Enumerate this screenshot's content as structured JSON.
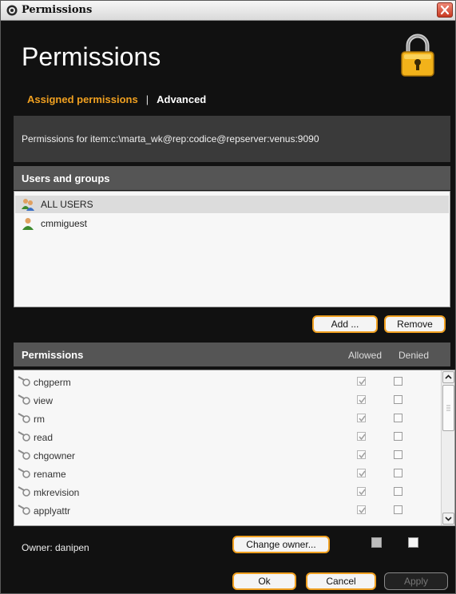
{
  "window": {
    "title": "Permissions"
  },
  "header": {
    "title": "Permissions",
    "tabs": [
      {
        "label": "Assigned permissions",
        "active": true
      },
      {
        "label": "Advanced",
        "active": false
      }
    ]
  },
  "path_text": "Permissions for item:c:\\marta_wk@rep:codice@repserver:venus:9090",
  "users": {
    "header": "Users and groups",
    "items": [
      {
        "name": "ALL USERS",
        "selected": true,
        "icon": "group-icon"
      },
      {
        "name": "cmmiguest",
        "selected": false,
        "icon": "user-icon"
      }
    ],
    "add_label": "Add ...",
    "remove_label": "Remove"
  },
  "permissions": {
    "header": "Permissions",
    "col_allowed": "Allowed",
    "col_denied": "Denied",
    "items": [
      {
        "name": "chgperm",
        "allowed": true,
        "denied": false
      },
      {
        "name": "view",
        "allowed": true,
        "denied": false
      },
      {
        "name": "rm",
        "allowed": true,
        "denied": false
      },
      {
        "name": "read",
        "allowed": true,
        "denied": false
      },
      {
        "name": "chgowner",
        "allowed": true,
        "denied": false
      },
      {
        "name": "rename",
        "allowed": true,
        "denied": false
      },
      {
        "name": "mkrevision",
        "allowed": true,
        "denied": false
      },
      {
        "name": "applyattr",
        "allowed": true,
        "denied": false
      }
    ]
  },
  "footer": {
    "owner_label": "Owner: danipen",
    "change_owner_label": "Change owner...",
    "ok_label": "Ok",
    "cancel_label": "Cancel",
    "apply_label": "Apply"
  },
  "colors": {
    "accent": "#f0a020",
    "background": "#111111",
    "panel": "#3a3a3a",
    "section_header": "#555555"
  }
}
